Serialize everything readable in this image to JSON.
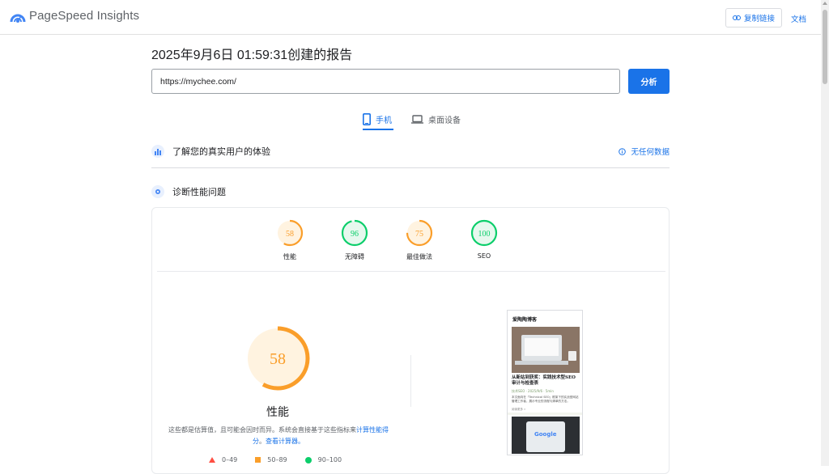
{
  "header": {
    "brand": "PageSpeed Insights",
    "copy_link_label": "复制链接",
    "docs_label": "文档",
    "accent_color": "#1a73e8"
  },
  "report": {
    "title": "2025年9月6日 01:59:31创建的报告",
    "url_value": "https://mychee.com/",
    "analyze_label": "分析"
  },
  "tabs": [
    {
      "label": "手机",
      "icon": "smartphone-icon",
      "active": true
    },
    {
      "label": "桌面设备",
      "icon": "laptop-icon",
      "active": false
    }
  ],
  "field_section": {
    "label": "了解您的真实用户的体验",
    "no_data_label": "无任何数据",
    "icon": "people-chart-icon"
  },
  "diagnose_section": {
    "label": "诊断性能问题",
    "icon": "lighthouse-icon"
  },
  "scores": [
    {
      "label": "性能",
      "value": 58,
      "color": "#fa9e2a"
    },
    {
      "label": "无障碍",
      "value": 96,
      "color": "#0cce6b"
    },
    {
      "label": "最佳做法",
      "value": 75,
      "color": "#fa9e2a"
    },
    {
      "label": "SEO",
      "value": 100,
      "color": "#0cce6b"
    }
  ],
  "performance": {
    "score": 58,
    "title": "性能",
    "desc_before": "这些都是估算值，且可能会因时而异。系统会直接基于这些指标来",
    "desc_link1": "计算性能得分",
    "desc_mid": "。",
    "desc_link2": "查看计算器。"
  },
  "legend": [
    {
      "range": "0–49",
      "color": "#ff4e42",
      "shape": "triangle"
    },
    {
      "range": "50–89",
      "color": "#fa9e2a",
      "shape": "square"
    },
    {
      "range": "90–100",
      "color": "#0cce6b",
      "shape": "circle"
    }
  ],
  "screenshot": {
    "site_title": "爱陶陶博客",
    "headline": "从新站到获奖：实践技术型SEO审计与检查表",
    "meta": "技术SEO · 2025/9/6 · 5min",
    "body": "本文面向在「Technical SEO」框架下的实战型网站管理工作者，展示专业的流程与清单的方法。",
    "more": "阅读更多 »",
    "image2_text": "Google"
  }
}
